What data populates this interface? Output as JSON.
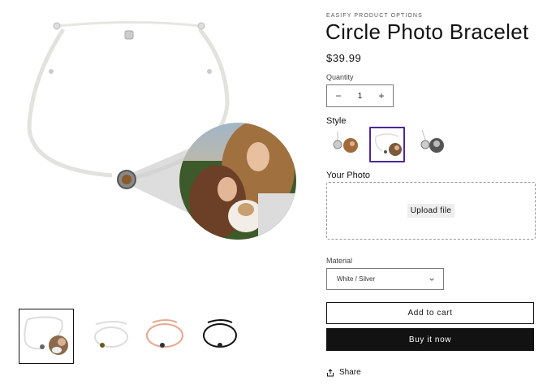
{
  "gallery": {
    "main_image_alt": "",
    "thumbnails": [
      {
        "name": "thumb-bracelet-with-photo"
      },
      {
        "name": "thumb-white-bracelet"
      },
      {
        "name": "thumb-pink-bracelet"
      },
      {
        "name": "thumb-black-bracelet"
      }
    ]
  },
  "product": {
    "vendor": "EASIFY PRODUCT OPTIONS",
    "title": "Circle Photo Bracelet",
    "price": "$39.99"
  },
  "quantity": {
    "label": "Quantity",
    "value": "1",
    "minus": "−",
    "plus": "+"
  },
  "style": {
    "label": "Style",
    "selected_index": 1
  },
  "photo": {
    "label": "Your Photo",
    "upload_label": "Upload file"
  },
  "material": {
    "label": "Material",
    "selected": "White / Silver"
  },
  "actions": {
    "add_to_cart": "Add to cart",
    "buy_now": "Buy it now",
    "share": "Share"
  },
  "colors": {
    "accent_selected": "#4a2a9a",
    "button_dark": "#121212"
  }
}
